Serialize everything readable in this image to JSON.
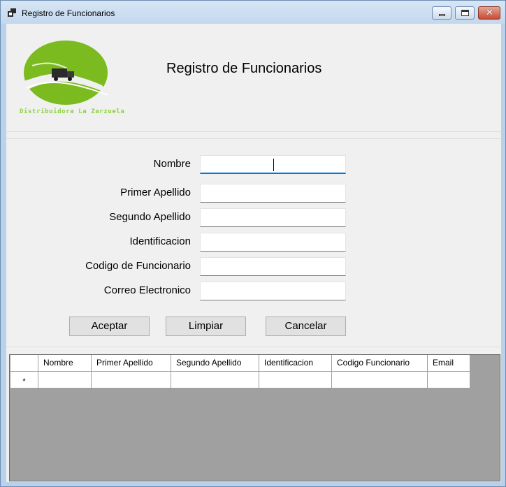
{
  "window": {
    "title": "Registro de Funcionarios",
    "controls": {
      "minimize": "minimize",
      "maximize": "maximize",
      "close": "✕"
    }
  },
  "header": {
    "logo_text": "Distribuidora La Zarzuela",
    "title": "Registro de Funcionarios",
    "colors": {
      "logo_green": "#7cbb1f",
      "logo_caption": "#8bd13a"
    }
  },
  "form": {
    "fields": [
      {
        "label": "Nombre",
        "value": ""
      },
      {
        "label": "Primer Apellido",
        "value": ""
      },
      {
        "label": "Segundo Apellido",
        "value": ""
      },
      {
        "label": "Identificacion",
        "value": ""
      },
      {
        "label": "Codigo de Funcionario",
        "value": ""
      },
      {
        "label": "Correo Electronico",
        "value": ""
      }
    ]
  },
  "buttons": {
    "accept": "Aceptar",
    "clear": "Limpiar",
    "cancel": "Cancelar"
  },
  "grid": {
    "columns": [
      "Nombre",
      "Primer Apellido",
      "Segundo Apellido",
      "Identificacion",
      "Codigo Funcionario",
      "Email"
    ],
    "new_row_marker": "*"
  }
}
